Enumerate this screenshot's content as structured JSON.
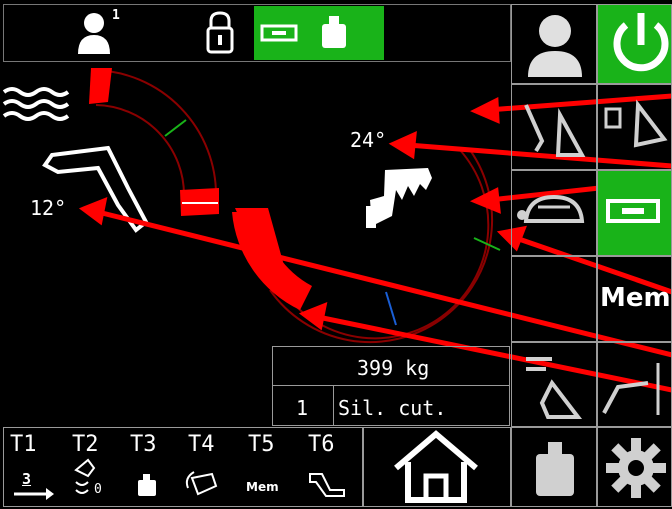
{
  "top_bar": {
    "user_level": "1"
  },
  "gauges": {
    "left_angle": "12°",
    "right_angle": "24°"
  },
  "info_panel": {
    "weight": "399 kg",
    "index": "1",
    "mode": "Sil. cut."
  },
  "tool_tabs": [
    {
      "label": "T1",
      "sub": "3"
    },
    {
      "label": "T2",
      "sub": "0"
    },
    {
      "label": "T3",
      "sub": ""
    },
    {
      "label": "T4",
      "sub": ""
    },
    {
      "label": "T5",
      "sub": "Mem"
    },
    {
      "label": "T6",
      "sub": ""
    }
  ],
  "right_panel": {
    "mem_label": "Mem"
  },
  "colors": {
    "accent_green": "#19b319",
    "indicator_red": "#ff0000",
    "arc_dark_red": "#8a0000",
    "tick_green": "#19b319",
    "tick_blue": "#1a5fd6"
  }
}
